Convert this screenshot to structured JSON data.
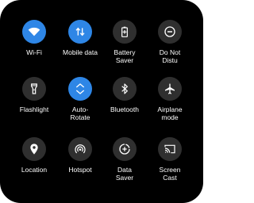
{
  "tiles": [
    {
      "label": "Wi-Fi",
      "icon": "wifi-icon",
      "active": true
    },
    {
      "label": "Mobile data",
      "icon": "mobile-data-icon",
      "active": true
    },
    {
      "label": "Battery\nSaver",
      "icon": "battery-icon",
      "active": false
    },
    {
      "label": "Do Not\nDistu",
      "icon": "do-not-disturb-icon",
      "active": false
    },
    {
      "label": "Flashlight",
      "icon": "flashlight-icon",
      "active": false
    },
    {
      "label": "Auto-\nRotate",
      "icon": "auto-rotate-icon",
      "active": true
    },
    {
      "label": "Bluetooth",
      "icon": "bluetooth-icon",
      "active": false
    },
    {
      "label": "Airplane\nmode",
      "icon": "airplane-icon",
      "active": false
    },
    {
      "label": "Location",
      "icon": "location-icon",
      "active": false
    },
    {
      "label": "Hotspot",
      "icon": "hotspot-icon",
      "active": false
    },
    {
      "label": "Data\nSaver",
      "icon": "data-saver-icon",
      "active": false
    },
    {
      "label": "Screen\nCast",
      "icon": "screen-cast-icon",
      "active": false
    }
  ],
  "colors": {
    "background": "#000000",
    "active": "#2e86e6",
    "inactive": "#2f2f2f",
    "text": "#ffffff"
  }
}
